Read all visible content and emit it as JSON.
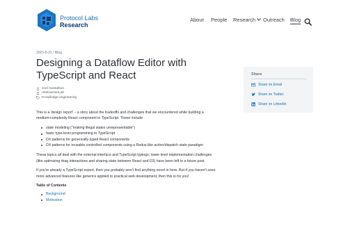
{
  "brand": {
    "line1": "Protocol Labs",
    "line2": "Research"
  },
  "nav": {
    "items": [
      {
        "label": "About"
      },
      {
        "label": "People"
      },
      {
        "label": "Research"
      },
      {
        "label": "Outreach"
      },
      {
        "label": "Blog"
      }
    ],
    "active": "Blog",
    "search_icon": "search-icon"
  },
  "article": {
    "meta": "2021-5-21 / Blog",
    "title": "Designing a Dataflow Editor with TypeScript and React",
    "authors": [
      {
        "icon": "person-icon",
        "text": "Joel Gustafson"
      },
      {
        "icon": "group-icon",
        "text": "AbstractionLab"
      },
      {
        "icon": "tag-icon",
        "text": "Knowledge engineering"
      }
    ],
    "intro": "This is a 'design report' – a story about the tradeoffs and challenges that we encountered while building a medium-complexity React component in TypeScript. These include",
    "bullets": [
      "state modeling (\"making illegal states unrepresentable\")",
      "basic type-level programming in TypeScript",
      "DX patterns for generically typed React components",
      "DX patterns for reusable controlled components using a Redux-like action/dispatch state paradigm"
    ],
    "para2": "These topics all deal with the external interface and TypeScript typings; lower-level implementation challenges (like optimizing drag interactions and sharing state between React and D3) have been left to a future post.",
    "para3": "If you're already a TypeScript expert, then you probably won't find anything novel in here. But if you haven't seen more advanced features like generics applied to practical web development, then this is for you!",
    "toc_title": "Table of Contents",
    "toc": [
      "Background",
      "Motivation"
    ]
  },
  "share": {
    "title": "Share",
    "links": [
      {
        "icon": "email-icon",
        "label": "Share on Email"
      },
      {
        "icon": "twitter-icon",
        "label": "Share on Twitter"
      },
      {
        "icon": "linkedin-icon",
        "label": "Share on LinkedIn"
      }
    ]
  },
  "colors": {
    "accent": "#1a6fb3",
    "brand_dark": "#0e3a66",
    "panel": "#f2f4f5"
  }
}
